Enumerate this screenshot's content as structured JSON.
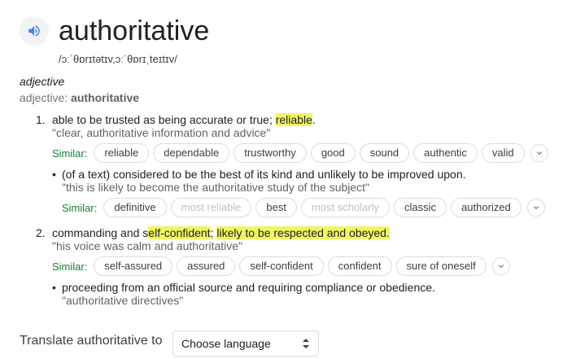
{
  "word": "authoritative",
  "phonetic": "/ɔːˈθɒrɪtətɪv,ɔːˈθɒrɪˌteɪtɪv/",
  "part_of_speech": "adjective",
  "pos_prefix": "adjective:",
  "pos_word": "authoritative",
  "senses": [
    {
      "number": "1.",
      "def_pre": "able to be trusted as being accurate or true; ",
      "def_hl": "reliable",
      "def_post": ".",
      "example": "\"clear, authoritative information and advice\"",
      "similar_label": "Similar:",
      "similar": [
        "reliable",
        "dependable",
        "trustworthy",
        "good",
        "sound",
        "authentic",
        "valid"
      ],
      "sub": {
        "bullet": "•",
        "def": "(of a text) considered to be the best of its kind and unlikely to be improved upon.",
        "example": "\"this is likely to become the authoritative study of the subject\"",
        "similar_label": "Similar:",
        "similar": [
          "definitive",
          "most reliable",
          "best",
          "most scholarly",
          "classic",
          "authorized"
        ]
      }
    },
    {
      "number": "2.",
      "def_pre": "commanding and s",
      "def_hl1": "elf-confident",
      "def_mid": "; ",
      "def_hl2": "likely to be respected and obeyed.",
      "example": "\"his voice was calm and authoritative\"",
      "similar_label": "Similar:",
      "similar": [
        "self-assured",
        "assured",
        "self-confident",
        "confident",
        "sure of oneself"
      ],
      "sub": {
        "bullet": "•",
        "def": "proceeding from an official source and requiring compliance or obedience.",
        "example": "\"authoritative directives\""
      }
    }
  ],
  "translate": {
    "label": "Translate authoritative to",
    "select_value": "Choose language"
  },
  "icons": {
    "speaker": "speaker-icon",
    "expand": "chevron-down-icon",
    "select_arrows": "select-arrows-icon"
  },
  "colors": {
    "highlight": "#f2f562",
    "similar_label": "#188038",
    "speaker": "#4285f4"
  }
}
